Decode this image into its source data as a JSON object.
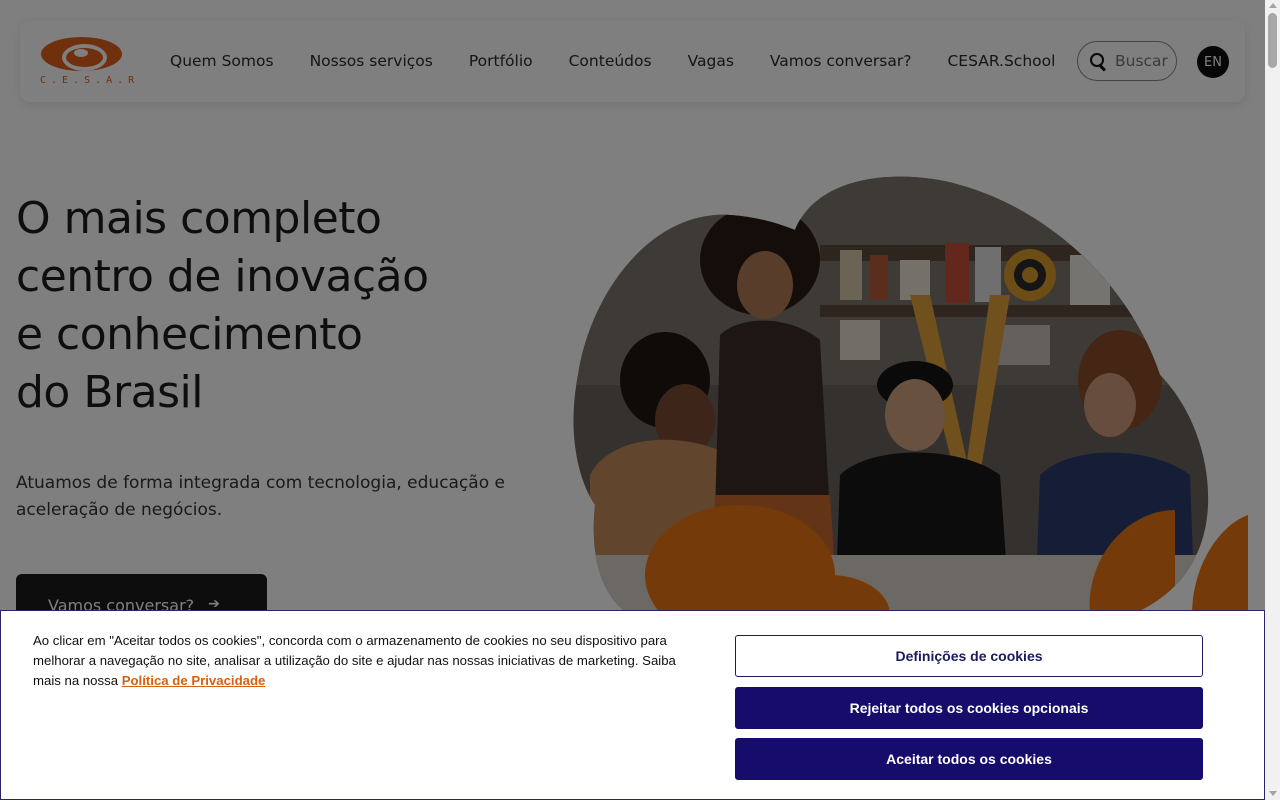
{
  "header": {
    "logo_text": "C.E.S.A.R",
    "nav": [
      {
        "label": "Quem Somos"
      },
      {
        "label": "Nossos serviços"
      },
      {
        "label": "Portfólio"
      },
      {
        "label": "Conteúdos"
      },
      {
        "label": "Vagas"
      },
      {
        "label": "Vamos conversar?"
      },
      {
        "label": "CESAR.School"
      }
    ],
    "search": {
      "placeholder": "Buscar",
      "icon": "search-icon"
    },
    "language": "EN"
  },
  "hero": {
    "title_lines": [
      "O mais completo",
      "centro de inovação",
      "e conhecimento",
      "do Brasil"
    ],
    "subtitle": "Atuamos de forma integrada com tecnologia, educação e aceleração de negócios.",
    "cta_label": "Vamos conversar?",
    "cta_icon": "arrow-right-icon"
  },
  "cookie_banner": {
    "text": "Ao clicar em \"Aceitar todos os cookies\", concorda com o armazenamento de cookies no seu dispositivo para melhorar a navegação no site, analisar a utilização do site e ajudar nas nossas iniciativas de marketing. Saiba mais na nossa",
    "privacy_link": "Política de Privacidade",
    "settings_button": "Definições de cookies",
    "reject_button": "Rejeitar todos os cookies opcionais",
    "accept_button": "Aceitar todos os cookies"
  },
  "colors": {
    "brand_orange": "#e2611b",
    "cookie_button": "#150c6b",
    "cta_background": "#1a1a1a"
  }
}
